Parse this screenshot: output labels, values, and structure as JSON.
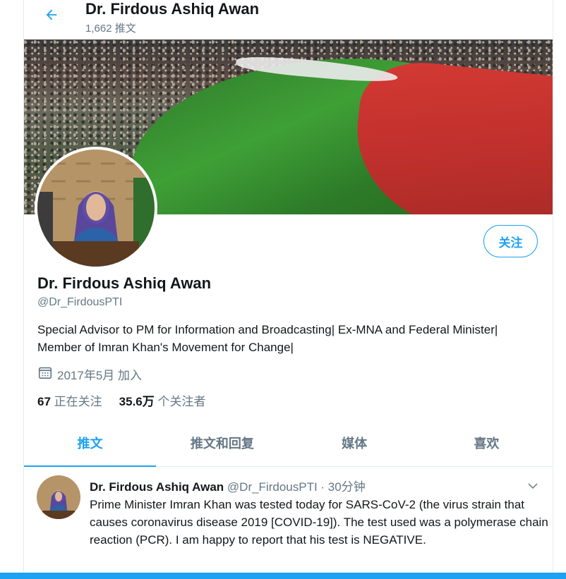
{
  "header": {
    "name": "Dr. Firdous Ashiq Awan",
    "tweet_count": "1,662 推文"
  },
  "profile": {
    "name": "Dr. Firdous Ashiq Awan",
    "handle": "@Dr_FirdousPTI",
    "bio": "Special Advisor to PM for Information and Broadcasting| Ex-MNA and Federal Minister| Member of Imran Khan's Movement for Change|",
    "joined": "2017年5月 加入",
    "following_count": "67",
    "following_label": "正在关注",
    "followers_count": "35.6万",
    "followers_label": "个关注者",
    "follow_button": "关注"
  },
  "tabs": [
    {
      "label": "推文",
      "active": true
    },
    {
      "label": "推文和回复",
      "active": false
    },
    {
      "label": "媒体",
      "active": false
    },
    {
      "label": "喜欢",
      "active": false
    }
  ],
  "tweet": {
    "name": "Dr. Firdous Ashiq Awan",
    "handle_time": "@Dr_FirdousPTI · 30分钟",
    "text": "Prime Minister Imran Khan was tested today for SARS-CoV-2 (the virus strain that causes coronavirus disease 2019 [COVID-19]). The test used was a polymerase chain reaction (PCR). I am happy to report that his test is NEGATIVE."
  },
  "colors": {
    "accent": "#1da1f2",
    "secondary_text": "#657786"
  },
  "icons": [
    "arrow-left-icon",
    "calendar-icon",
    "chevron-down-icon"
  ]
}
